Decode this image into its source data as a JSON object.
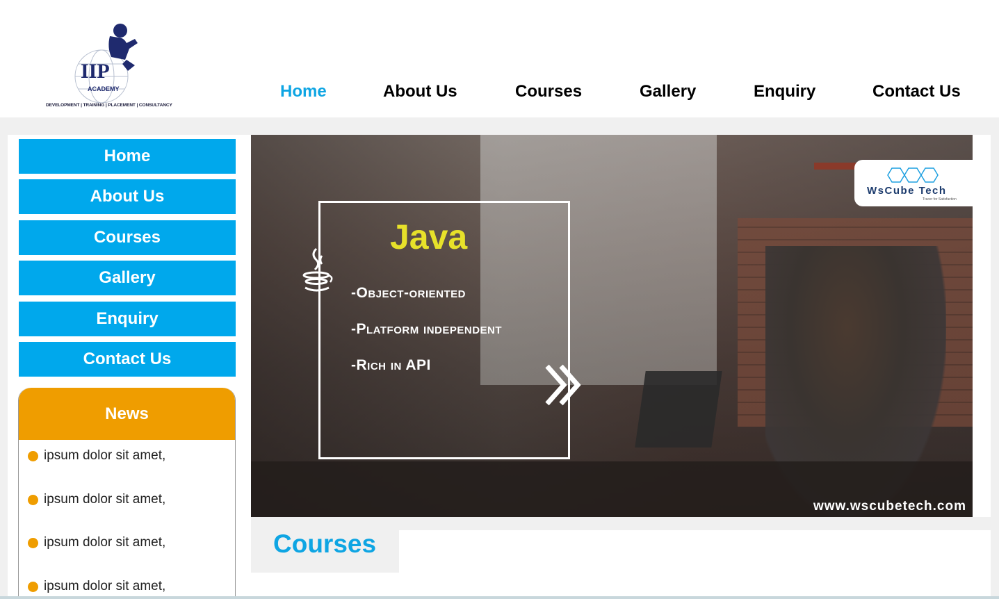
{
  "logo": {
    "name": "IIP",
    "sub": "ACADEMY",
    "tagline": "DEVELOPMENT | TRAINING | PLACEMENT | CONSULTANCY"
  },
  "topnav": {
    "items": [
      {
        "label": "Home",
        "active": true
      },
      {
        "label": "About Us",
        "active": false
      },
      {
        "label": "Courses",
        "active": false
      },
      {
        "label": "Gallery",
        "active": false
      },
      {
        "label": "Enquiry",
        "active": false
      },
      {
        "label": "Contact Us",
        "active": false
      }
    ]
  },
  "sidebar": {
    "items": [
      {
        "label": "Home"
      },
      {
        "label": "About Us"
      },
      {
        "label": "Courses"
      },
      {
        "label": "Gallery"
      },
      {
        "label": "Enquiry"
      },
      {
        "label": "Contact Us"
      }
    ]
  },
  "news": {
    "title": "News",
    "items": [
      "ipsum dolor sit amet,",
      "ipsum dolor sit amet,",
      "ipsum dolor sit amet,",
      "ipsum dolor sit amet,"
    ]
  },
  "banner": {
    "title": "Java",
    "lines": [
      "-Object-oriented",
      "-Platform independent",
      "-Rich in API"
    ],
    "brand": "WsCube Tech",
    "brand_sub": "Tracer for Satisfaction",
    "url": "www.wscubetech.com"
  },
  "section": {
    "title": "Courses"
  },
  "colors": {
    "accent": "#0ea5e3",
    "sidebar": "#00a8ec",
    "news": "#ef9d00",
    "java_title": "#e7e12a"
  }
}
